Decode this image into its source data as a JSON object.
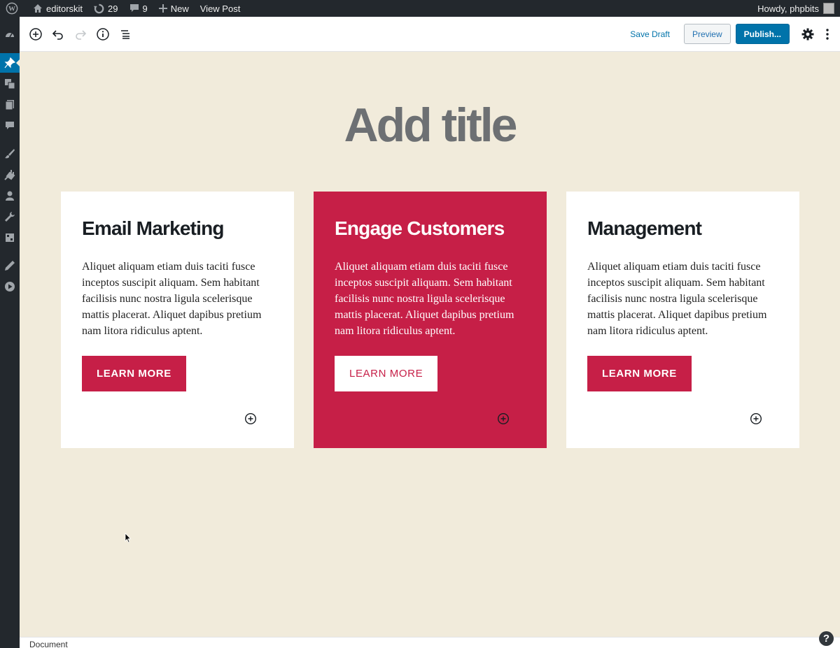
{
  "adminbar": {
    "site_name": "editorskit",
    "updates_count": "29",
    "comments_count": "9",
    "new_label": "New",
    "view_post_label": "View Post",
    "howdy": "Howdy, phpbits"
  },
  "admin_menu": [
    "dashboard-icon",
    "posts-icon",
    "media-icon",
    "pages-icon",
    "comments-icon",
    "appearance-icon",
    "plugins-icon",
    "users-icon",
    "tools-icon",
    "settings-icon",
    "editor-icon",
    "play-icon"
  ],
  "toolbar": {
    "save_draft": "Save Draft",
    "preview": "Preview",
    "publish": "Publish..."
  },
  "post": {
    "title_placeholder": "Add title"
  },
  "cards": [
    {
      "heading": "Email Marketing",
      "text": "Aliquet aliquam etiam duis taciti fusce inceptos suscipit aliquam. Sem habitant facilisis nunc nostra ligula scelerisque mattis placerat. Aliquet dapibus pretium nam litora ridiculus aptent.",
      "button": "LEARN MORE"
    },
    {
      "heading": "Engage Customers",
      "text": "Aliquet aliquam etiam duis taciti fusce inceptos suscipit aliquam. Sem habitant facilisis nunc nostra ligula scelerisque mattis placerat. Aliquet dapibus pretium nam litora ridiculus aptent.",
      "button": "LEARN MORE"
    },
    {
      "heading": "Management",
      "text": "Aliquet aliquam etiam duis taciti fusce inceptos suscipit aliquam. Sem habitant facilisis nunc nostra ligula scelerisque mattis placerat. Aliquet dapibus pretium nam litora ridiculus aptent.",
      "button": "LEARN MORE"
    }
  ],
  "footer": {
    "breadcrumb": "Document",
    "help": "?"
  },
  "colors": {
    "accent": "#c61f47",
    "background": "#f1ebdb",
    "wp_blue": "#0073aa"
  }
}
